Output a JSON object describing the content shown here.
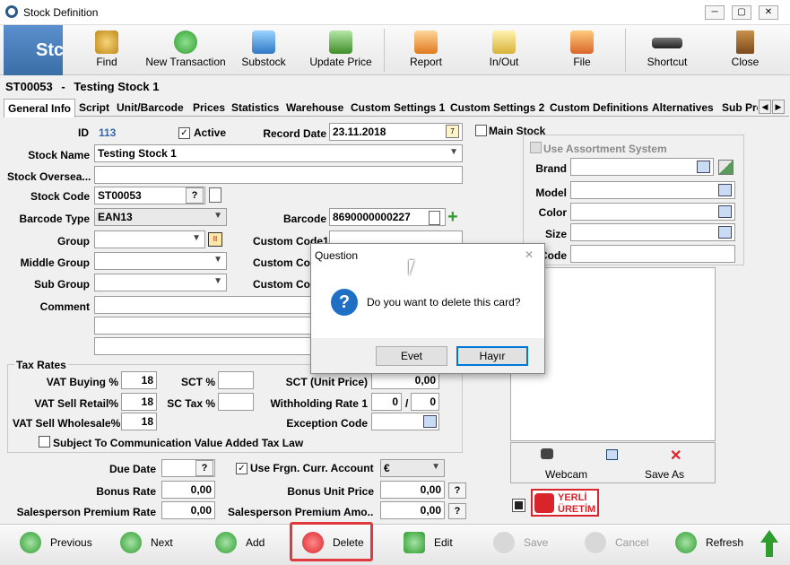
{
  "window": {
    "title": "Stock Definition",
    "min": "─",
    "max": "▢",
    "close": "✕"
  },
  "toolbar": {
    "brand": "Stc",
    "find": "Find",
    "new_transaction": "New Transaction",
    "substock": "Substock",
    "update_price": "Update Price",
    "report": "Report",
    "in_out": "In/Out",
    "file": "File",
    "shortcut": "Shortcut",
    "close": "Close"
  },
  "stock_header": {
    "code": "ST00053",
    "sep": "-",
    "name": "Testing Stock  1"
  },
  "tabs": [
    "General Info",
    "Script",
    "Unit/Barcode",
    "Prices",
    "Statistics",
    "Warehouse",
    "Custom Settings 1",
    "Custom Settings 2",
    "Custom Definitions",
    "Alternatives",
    "Sub Pro"
  ],
  "form": {
    "id_label": "ID",
    "id_value": "113",
    "active_label": "Active",
    "record_date_label": "Record Date",
    "record_date": "23.11.2018",
    "stock_name_label": "Stock Name",
    "stock_name": "Testing Stock  1",
    "stock_oversea_label": "Stock Oversea...",
    "stock_code_label": "Stock Code",
    "stock_code": "ST00053",
    "q": "?",
    "barcode_type_label": "Barcode Type",
    "barcode_type": "EAN13",
    "barcode_label": "Barcode",
    "barcode": "8690000000227",
    "group_label": "Group",
    "middle_group_label": "Middle Group",
    "sub_group_label": "Sub Group",
    "custom_code1_label": "Custom Code1",
    "custom_code_label": "Custom Cod",
    "custom_code3_label": "Custom Cod",
    "comment_label": "Comment"
  },
  "tax": {
    "title": "Tax Rates",
    "vat_buying_label": "VAT Buying %",
    "vat_buying": "18",
    "vat_sell_retail_label": "VAT Sell Retail%",
    "vat_sell_retail": "18",
    "vat_sell_wholesale_label": "VAT Sell Wholesale%",
    "vat_sell_wholesale": "18",
    "sct_label": "SCT %",
    "sct_tax_label": "SC Tax %",
    "sct_unit_price_label": "SCT (Unit Price)",
    "sct_unit_price": "0,00",
    "withholding_label": "Withholding Rate 1",
    "withholding_a": "0",
    "withholding_slash": "/",
    "withholding_b": "0",
    "exception_code_label": "Exception Code",
    "communication_label": "Subject To Communication Value Added Tax Law"
  },
  "lower": {
    "due_date_label": "Due Date",
    "q": "?",
    "frgn_label": "Use Frgn. Curr. Account",
    "currency": "€",
    "bonus_rate_label": "Bonus Rate",
    "bonus_rate": "0,00",
    "bonus_unit_price_label": "Bonus Unit Price",
    "bonus_unit_price": "0,00",
    "sp_rate_label": "Salesperson Premium Rate",
    "sp_rate": "0,00",
    "sp_amount_label": "Salesperson Premium Amo...",
    "sp_amount": "0,00"
  },
  "right": {
    "main_stock_label": "Main Stock",
    "assortment_label": "Use Assortment System",
    "brand_label": "Brand",
    "model_label": "Model",
    "color_label": "Color",
    "size_label": "Size",
    "code_label": "Code",
    "webcam": "Webcam",
    "save_as": "Save As",
    "yerli_1": "YERLİ",
    "yerli_2": "ÜRETİM"
  },
  "dialog": {
    "title": "Question",
    "message": "Do you want to delete this card?",
    "yes": "Evet",
    "no": "Hayır",
    "icon": "?",
    "close": "✕"
  },
  "bottom": {
    "previous": "Previous",
    "next": "Next",
    "add": "Add",
    "delete": "Delete",
    "edit": "Edit",
    "save": "Save",
    "cancel": "Cancel",
    "refresh": "Refresh"
  },
  "colors": {
    "accent": "#3a6ea5",
    "delete_highlight": "#e0393e",
    "green": "#2e9d2e",
    "red": "#d9242b"
  }
}
